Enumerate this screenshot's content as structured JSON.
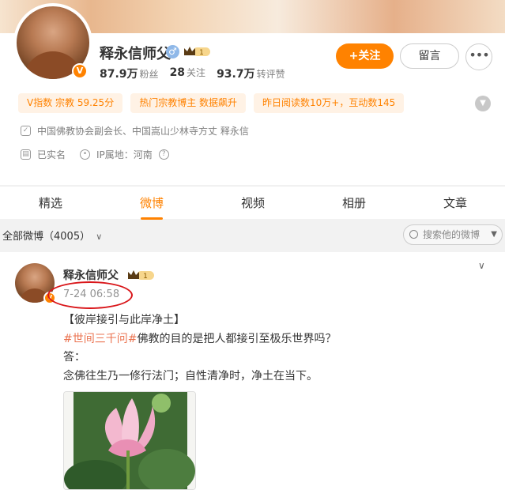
{
  "profile": {
    "name": "释永信师父",
    "gender_symbol": "♂",
    "vip_badge": "1",
    "verified_mark": "V",
    "stats": [
      {
        "value": "87.9万",
        "label": "粉丝"
      },
      {
        "value": "28",
        "label": "关注"
      },
      {
        "value": "93.7万",
        "label": "转评赞"
      }
    ],
    "follow_label": "+关注",
    "message_label": "留言",
    "more_label": "•••",
    "tags": [
      "V指数 宗教 59.25分",
      "热门宗教博主 数据飙升",
      "昨日阅读数10万+，互动数145"
    ],
    "intro": "中国佛教协会副会长、中国嵩山少林寺方丈 释永信",
    "real_name": "已实名",
    "ip_location": "IP属地：河南"
  },
  "tabs": [
    {
      "label": "精选",
      "active": false
    },
    {
      "label": "微博",
      "active": true
    },
    {
      "label": "视频",
      "active": false
    },
    {
      "label": "相册",
      "active": false
    },
    {
      "label": "文章",
      "active": false
    }
  ],
  "filter": {
    "label": "全部微博（4005）",
    "caret": "∨",
    "search_placeholder": "搜索他的微博"
  },
  "post": {
    "author": "释永信师父",
    "vip_badge": "1",
    "time": "7-24 06:58",
    "title_line": "【彼岸接引与此岸净土】",
    "hashtag": "#世间三千问#",
    "question": "佛教的目的是把人都接引至极乐世界吗？",
    "answer_label": "答：",
    "answer": "念佛往生乃一修行法门；自性清净时，净土在当下。"
  },
  "colors": {
    "accent": "#ff8200",
    "hashtag": "#eb7350",
    "highlight_circle": "#d9161a"
  }
}
